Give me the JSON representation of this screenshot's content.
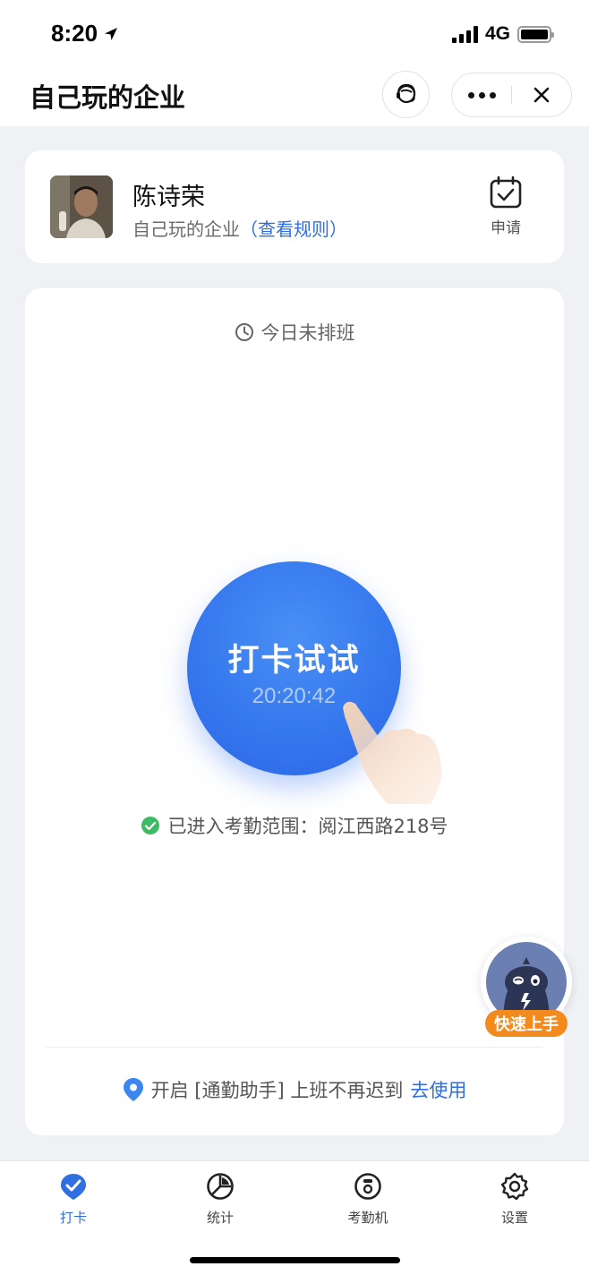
{
  "status_bar": {
    "time": "8:20",
    "network": "4G",
    "icons": [
      "location-arrow-icon",
      "signal-bars-icon",
      "battery-icon"
    ]
  },
  "header": {
    "title": "自己玩的企业",
    "icons": [
      "customer-service-icon",
      "more-dots-icon",
      "close-icon"
    ]
  },
  "profile": {
    "name": "陈诗荣",
    "company": "自己玩的企业",
    "rules_link": "（查看规则）",
    "apply_label": "申请",
    "apply_icon": "calendar-check-icon"
  },
  "main": {
    "schedule_status": "今日未排班",
    "schedule_icon": "clock-icon",
    "punch_button_label": "打卡试试",
    "punch_time": "20:20:42",
    "range_text": "已进入考勤范围：阅江西路218号",
    "range_icon": "check-circle-icon",
    "assist_text": "开启 [通勤助手] 上班不再迟到",
    "assist_link": "去使用",
    "assist_icon": "location-pin-icon"
  },
  "mascot": {
    "badge_label": "快速上手",
    "icon": "bird-mascot-icon"
  },
  "tabs": [
    {
      "label": "打卡",
      "icon": "punch-check-icon",
      "active": true
    },
    {
      "label": "统计",
      "icon": "pie-chart-icon",
      "active": false
    },
    {
      "label": "考勤机",
      "icon": "attendance-machine-icon",
      "active": false
    },
    {
      "label": "设置",
      "icon": "gear-icon",
      "active": false
    }
  ],
  "colors": {
    "accent": "#2f6fe0",
    "punch_button": "#3678ee",
    "success": "#3dbb63",
    "badge": "#f28a1e",
    "background": "#eff1f4"
  }
}
